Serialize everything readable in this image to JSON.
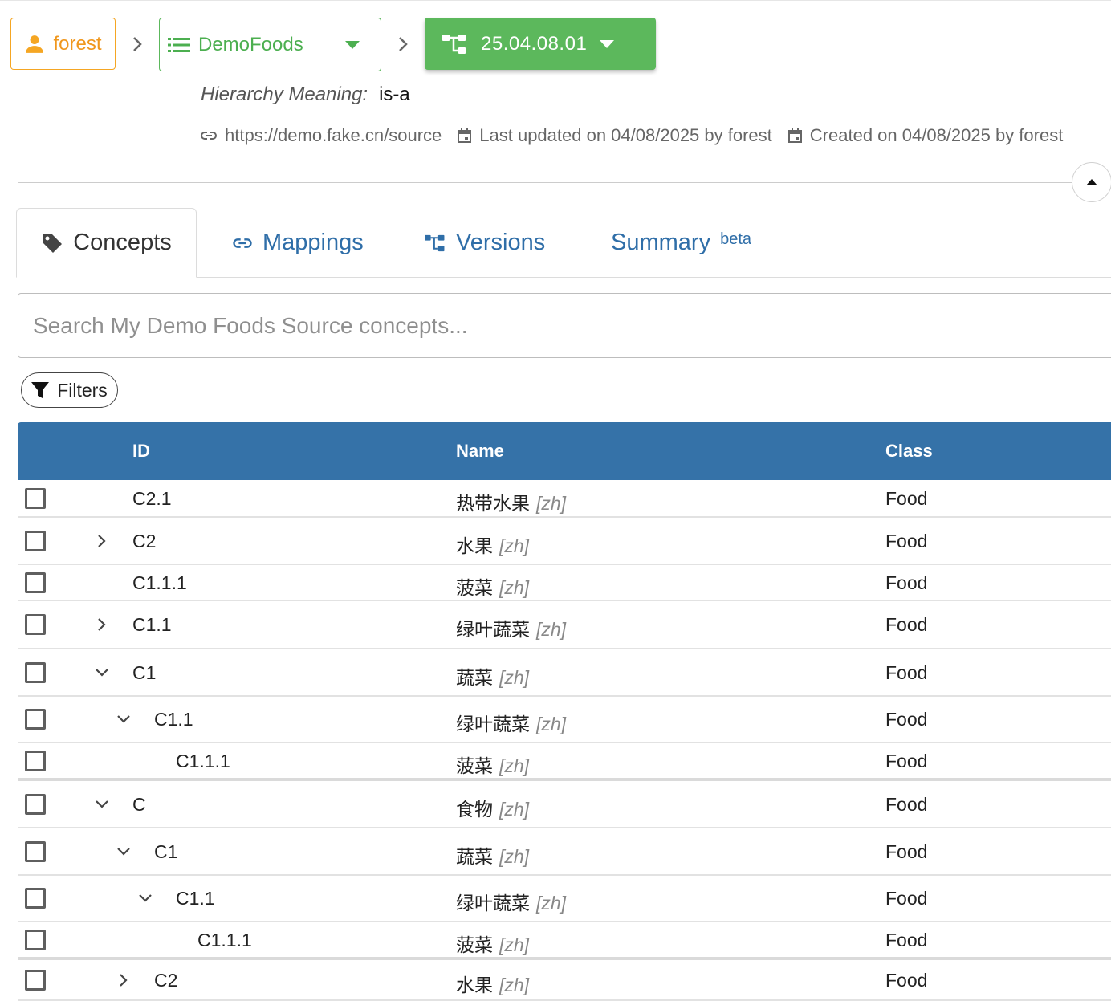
{
  "breadcrumb": {
    "owner": "forest",
    "repo": "DemoFoods",
    "version": "25.04.08.01"
  },
  "hierarchy": {
    "label": "Hierarchy Meaning:",
    "value": "is-a"
  },
  "meta": {
    "url": "https://demo.fake.cn/source",
    "updated": "Last updated on 04/08/2025 by forest",
    "created": "Created on 04/08/2025 by forest"
  },
  "tabs": {
    "concepts": "Concepts",
    "mappings": "Mappings",
    "versions": "Versions",
    "summary": "Summary",
    "summary_sup": "beta"
  },
  "search": {
    "placeholder": "Search My Demo Foods Source concepts..."
  },
  "filters": {
    "label": "Filters"
  },
  "table": {
    "headers": {
      "id": "ID",
      "name": "Name",
      "class": "Class"
    },
    "rows": [
      {
        "id": "C2.1",
        "name": "热带水果",
        "locale": "[zh]",
        "class": "Food"
      },
      {
        "id": "C2",
        "name": "水果",
        "locale": "[zh]",
        "class": "Food"
      },
      {
        "id": "C1.1.1",
        "name": "菠菜",
        "locale": "[zh]",
        "class": "Food"
      },
      {
        "id": "C1.1",
        "name": "绿叶蔬菜",
        "locale": "[zh]",
        "class": "Food"
      },
      {
        "id": "C1",
        "name": "蔬菜",
        "locale": "[zh]",
        "class": "Food"
      },
      {
        "id": "C1.1",
        "name": "绿叶蔬菜",
        "locale": "[zh]",
        "class": "Food"
      },
      {
        "id": "C1.1.1",
        "name": "菠菜",
        "locale": "[zh]",
        "class": "Food"
      },
      {
        "id": "C",
        "name": "食物",
        "locale": "[zh]",
        "class": "Food"
      },
      {
        "id": "C1",
        "name": "蔬菜",
        "locale": "[zh]",
        "class": "Food"
      },
      {
        "id": "C1.1",
        "name": "绿叶蔬菜",
        "locale": "[zh]",
        "class": "Food"
      },
      {
        "id": "C1.1.1",
        "name": "菠菜",
        "locale": "[zh]",
        "class": "Food"
      },
      {
        "id": "C2",
        "name": "水果",
        "locale": "[zh]",
        "class": "Food"
      }
    ]
  },
  "colors": {
    "owner": "#f0971d",
    "repo": "#5cb85c",
    "header": "#3572a8",
    "link": "#2f6ea8"
  },
  "icons": [
    "person-icon",
    "list-icon",
    "caret-down-icon",
    "hierarchy-icon",
    "link-icon",
    "calendar-icon",
    "tag-icon",
    "funnel-icon",
    "chevron-right-icon",
    "chevron-down-icon",
    "caret-up-icon"
  ]
}
